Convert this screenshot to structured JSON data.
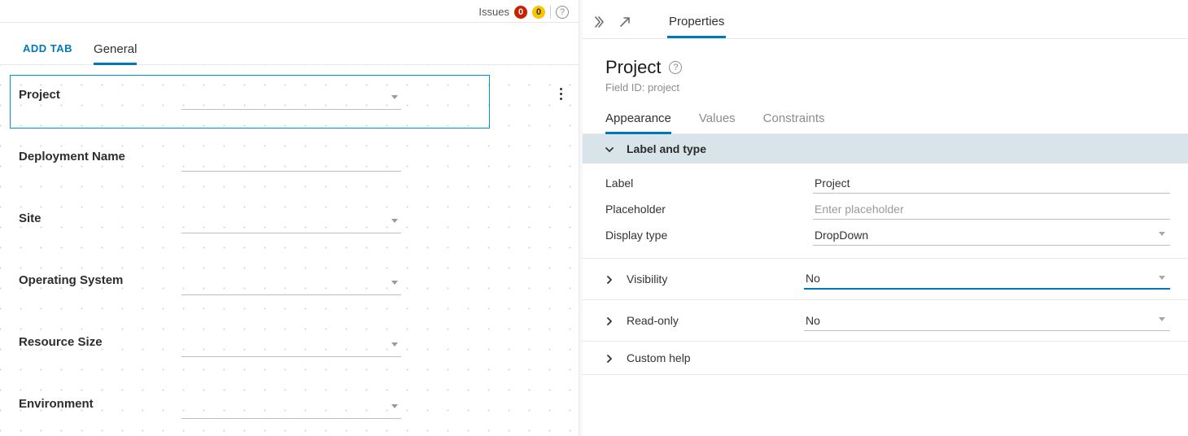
{
  "canvas": {
    "topbar": {
      "issues_label": "Issues",
      "errors_count": "0",
      "warnings_count": "0"
    },
    "add_tab_label": "ADD TAB",
    "tabs": [
      {
        "label": "General",
        "active": true
      }
    ],
    "fields": [
      {
        "label": "Project",
        "type": "dropdown",
        "selected": true
      },
      {
        "label": "Deployment Name",
        "type": "text",
        "selected": false
      },
      {
        "label": "Site",
        "type": "dropdown",
        "selected": false
      },
      {
        "label": "Operating System",
        "type": "dropdown",
        "selected": false
      },
      {
        "label": "Resource Size",
        "type": "dropdown",
        "selected": false
      },
      {
        "label": "Environment",
        "type": "dropdown",
        "selected": false
      }
    ]
  },
  "properties": {
    "panel_tab": "Properties",
    "heading": "Project",
    "field_id_label": "Field ID: project",
    "sub_tabs": {
      "appearance": "Appearance",
      "values": "Values",
      "constraints": "Constraints"
    },
    "sections": {
      "label_type": {
        "title": "Label and type",
        "rows": {
          "label_k": "Label",
          "label_v": "Project",
          "placeholder_k": "Placeholder",
          "placeholder_ph": "Enter placeholder",
          "display_type_k": "Display type",
          "display_type_v": "DropDown"
        }
      },
      "visibility": {
        "title": "Visibility",
        "value": "No"
      },
      "readonly": {
        "title": "Read-only",
        "value": "No"
      },
      "custom_help": {
        "title": "Custom help"
      }
    }
  }
}
